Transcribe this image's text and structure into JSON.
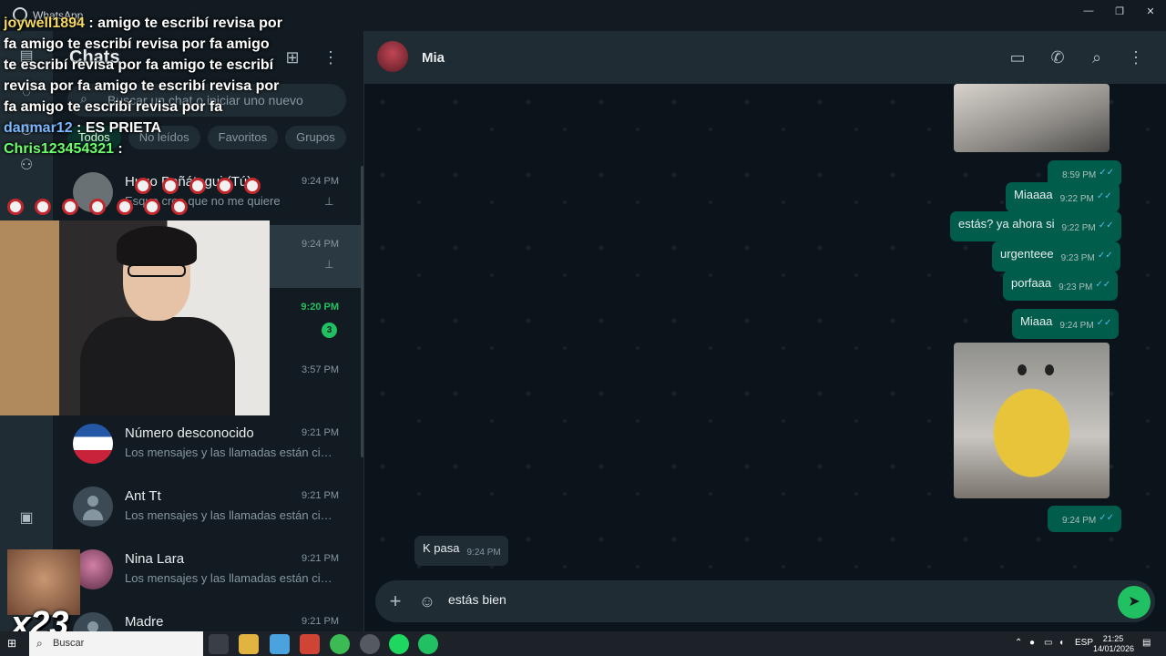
{
  "window": {
    "app_title": "WhatsApp",
    "controls": [
      "—",
      "❐",
      "✕"
    ]
  },
  "rail": {
    "icons": [
      "chats-icon",
      "status-icon",
      "channels-icon",
      "communities-icon",
      "media-icon"
    ]
  },
  "chat_list": {
    "title": "Chats",
    "search_placeholder": "Buscar un chat o iniciar uno nuevo",
    "filters": [
      "Todos",
      "No leídos",
      "Favoritos",
      "Grupos"
    ],
    "items": [
      {
        "name": "Hugo Peñátegui (Tú)",
        "time": "9:24 PM",
        "preview": "Esque creo que no me quiere",
        "pinned": true
      },
      {
        "name": "",
        "time": "9:24 PM",
        "preview": "",
        "pinned": true
      },
      {
        "name": "",
        "time": "9:20 PM",
        "preview": "",
        "unread": "3"
      },
      {
        "name": "",
        "time": "3:57 PM",
        "preview": ""
      },
      {
        "name": "Número desconocido",
        "time": "9:21 PM",
        "preview": "Los mensajes y las llamadas están cifr..."
      },
      {
        "name": "Ant Tt",
        "time": "9:21 PM",
        "preview": "Los mensajes y las llamadas están cifr..."
      },
      {
        "name": "Nina Lara",
        "time": "9:21 PM",
        "preview": "Los mensajes y las llamadas están cifr..."
      },
      {
        "name": "Madre",
        "time": "9:21 PM",
        "preview": ""
      }
    ]
  },
  "conversation": {
    "contact_name": "Mia",
    "messages": [
      {
        "type": "out-image-time",
        "time": "8:59 PM"
      },
      {
        "type": "out",
        "text": "Miaaaa",
        "time": "9:22 PM"
      },
      {
        "type": "out",
        "text": "estás? ya ahora si",
        "time": "9:22 PM"
      },
      {
        "type": "out",
        "text": "urgenteee",
        "time": "9:23 PM"
      },
      {
        "type": "out",
        "text": "porfaaa",
        "time": "9:23 PM"
      },
      {
        "type": "out",
        "text": "Miaaa",
        "time": "9:24 PM"
      },
      {
        "type": "out-image-time",
        "time": "9:24 PM"
      },
      {
        "type": "in",
        "text": "K pasa",
        "time": "9:24 PM"
      }
    ],
    "composer_text": "estás bien"
  },
  "stream_overlay": {
    "line0_user": "joywell1894",
    "line0_text": " : amigo te escribí revisa por fa amigo te escribí revisa por fa amigo te escribí revisa por fa amigo te escribí revisa por fa amigo te escribí revisa por fa amigo te escribí revisa por fa",
    "line1_user": "danmar12",
    "line1_text": " : ES PRIETA",
    "line2_user": "Chris123454321",
    "line2_text": " :",
    "sticker_text": "x23"
  },
  "taskbar": {
    "search_label": "Buscar",
    "lang": "ESP",
    "time": "21:25",
    "date": "14/01/2026"
  },
  "colors": {
    "accent": "#21c063",
    "outgoing_bubble": "#005c4b",
    "incoming_bubble": "#202c33",
    "panel": "#111b21"
  }
}
